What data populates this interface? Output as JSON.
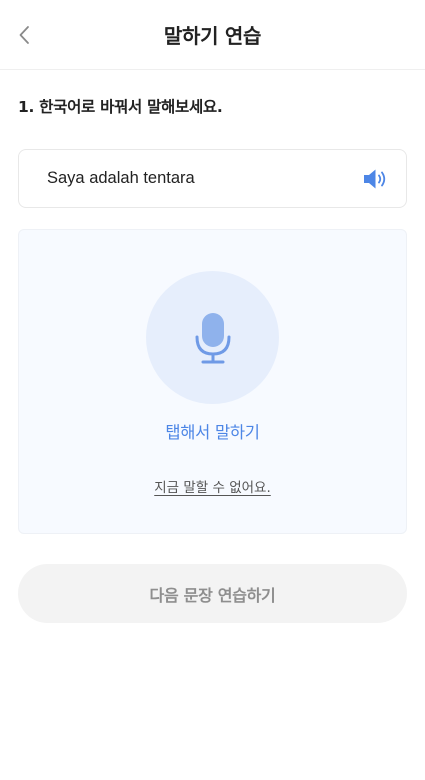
{
  "header": {
    "title": "말하기 연습",
    "back_icon": "chevron-left-icon"
  },
  "question": {
    "text": "1. 한국어로 바꿔서 말해보세요."
  },
  "prompt": {
    "sentence": "Saya adalah tentara",
    "audio_icon": "speaker-icon"
  },
  "recorder": {
    "mic_icon": "microphone-icon",
    "tap_label": "탭해서 말하기",
    "skip_link": "지금 말할 수 없어요."
  },
  "footer": {
    "next_button": "다음 문장 연습하기"
  },
  "colors": {
    "accent": "#4d86e6",
    "mic_circle": "#e6eefc",
    "panel_bg": "#f7faff",
    "disabled_button": "#f3f3f3"
  }
}
